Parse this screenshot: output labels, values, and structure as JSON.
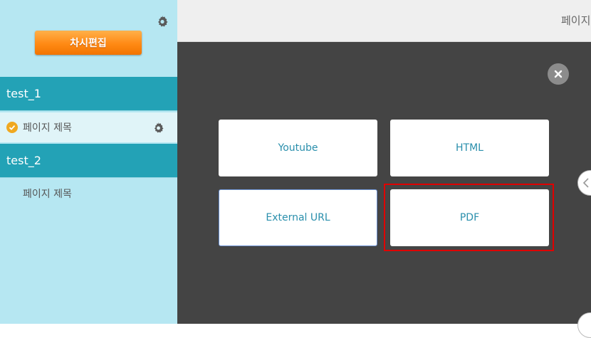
{
  "sidebar": {
    "edit_button_label": "차시편집",
    "sections": [
      {
        "title": "test_1",
        "pages": [
          {
            "label": "페이지 제목",
            "active": true
          }
        ]
      },
      {
        "title": "test_2",
        "pages": [
          {
            "label": "페이지 제목",
            "active": false
          }
        ]
      }
    ]
  },
  "header": {
    "title": "페이지"
  },
  "dialog": {
    "options": [
      {
        "label": "Youtube"
      },
      {
        "label": "HTML"
      },
      {
        "label": "External URL"
      },
      {
        "label": "PDF"
      }
    ],
    "close_icon": "close-icon"
  },
  "colors": {
    "sidebar_bg": "#b6e7f2",
    "section_bg": "#23a2b6",
    "accent_orange": "#ff8a14",
    "overlay_bg": "#444444",
    "option_text": "#2a8fac",
    "highlight": "#e00000"
  }
}
